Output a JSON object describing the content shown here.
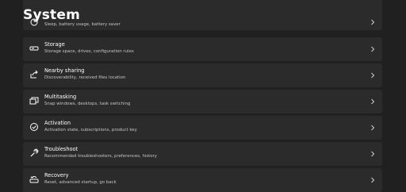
{
  "header": {
    "title": "System"
  },
  "items": [
    {
      "name": "power",
      "title": "",
      "subtitle": "Sleep, battery usage, battery saver",
      "icon": "power-icon"
    },
    {
      "name": "storage",
      "title": "Storage",
      "subtitle": "Storage space, drives, configuration rules",
      "icon": "storage-icon"
    },
    {
      "name": "nearby-sharing",
      "title": "Nearby sharing",
      "subtitle": "Discoverability, received files location",
      "icon": "share-icon"
    },
    {
      "name": "multitasking",
      "title": "Multitasking",
      "subtitle": "Snap windows, desktops, task switching",
      "icon": "multitasking-icon"
    },
    {
      "name": "activation",
      "title": "Activation",
      "subtitle": "Activation state, subscriptions, product key",
      "icon": "activation-icon"
    },
    {
      "name": "troubleshoot",
      "title": "Troubleshoot",
      "subtitle": "Recommended troubleshooters, preferences, history",
      "icon": "wrench-icon"
    },
    {
      "name": "recovery",
      "title": "Recovery",
      "subtitle": "Reset, advanced startup, go back",
      "icon": "recovery-icon"
    }
  ],
  "colors": {
    "background": "#202020",
    "card": "#2b2b2b",
    "text": "#ffffff",
    "subtext": "#c5c5c5"
  }
}
